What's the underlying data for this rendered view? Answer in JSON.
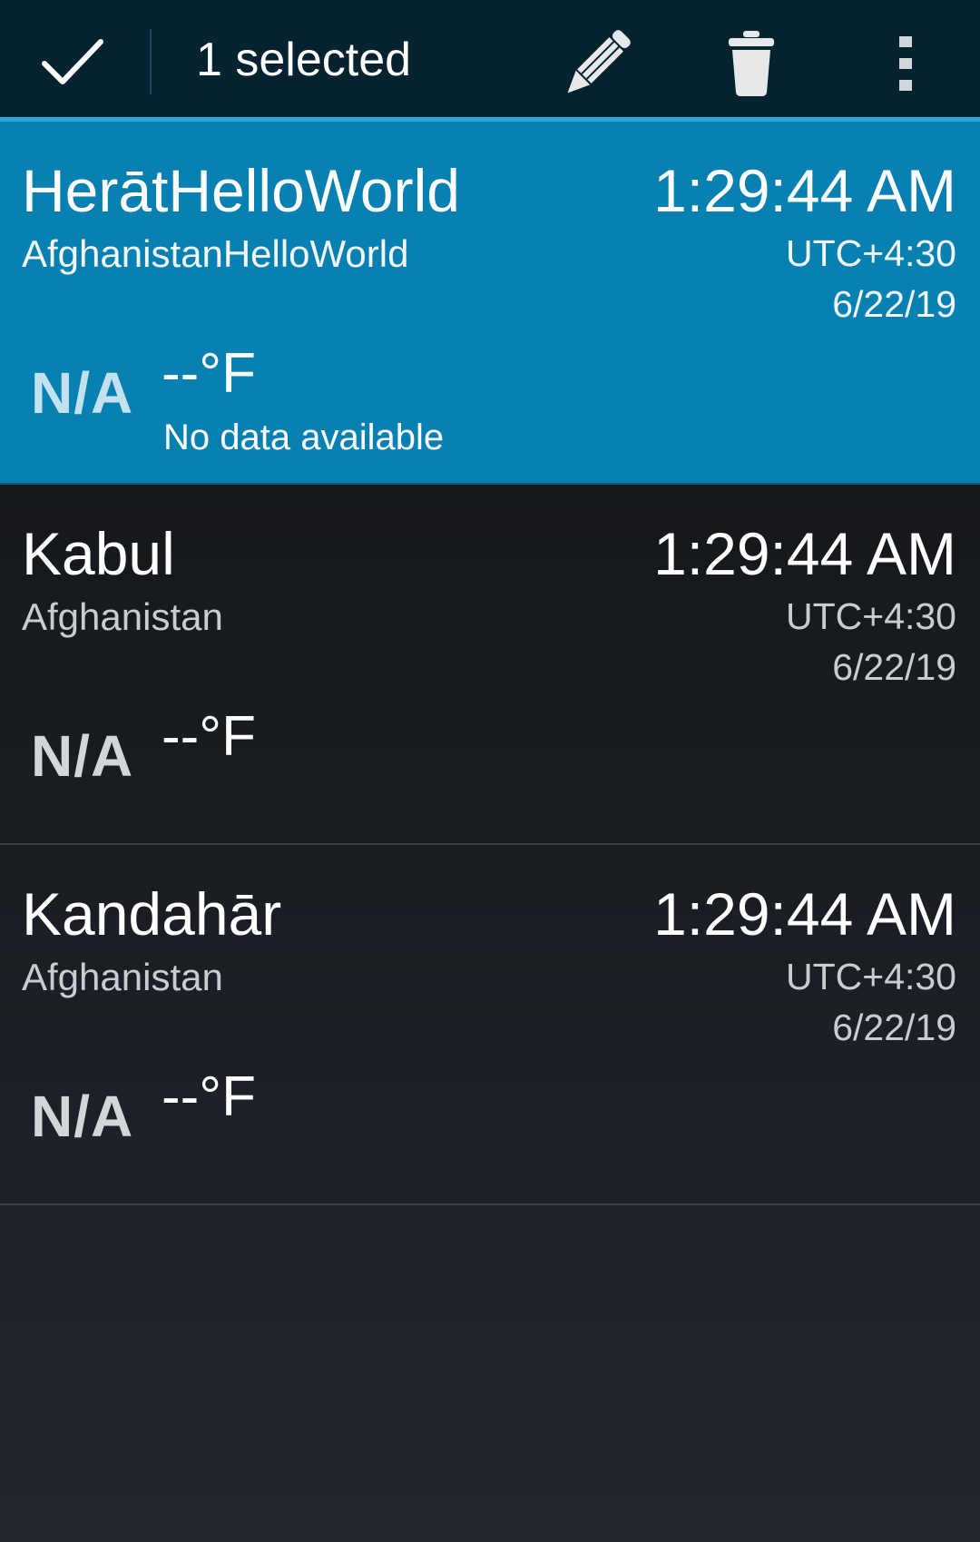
{
  "action_bar": {
    "title": "1 selected",
    "done_icon": "checkmark-icon",
    "edit_icon": "pencil-icon",
    "delete_icon": "trash-icon",
    "more_icon": "overflow-menu-icon"
  },
  "colors": {
    "action_bar_bg": "#04222f",
    "accent": "#2aa8d8",
    "selected_row_bg": "#0880b1"
  },
  "cities": [
    {
      "city": "HerātHelloWorld",
      "country": "AfghanistanHelloWorld",
      "time": "1:29:44 AM",
      "utc": "UTC+4:30",
      "date": "6/22/19",
      "weather_icon": "N/A",
      "temp": "--°F",
      "condition": "No data available",
      "selected": true
    },
    {
      "city": "Kabul",
      "country": "Afghanistan",
      "time": "1:29:44 AM",
      "utc": "UTC+4:30",
      "date": "6/22/19",
      "weather_icon": "N/A",
      "temp": "--°F",
      "selected": false
    },
    {
      "city": "Kandahār",
      "country": "Afghanistan",
      "time": "1:29:44 AM",
      "utc": "UTC+4:30",
      "date": "6/22/19",
      "weather_icon": "N/A",
      "temp": "--°F",
      "selected": false
    }
  ]
}
